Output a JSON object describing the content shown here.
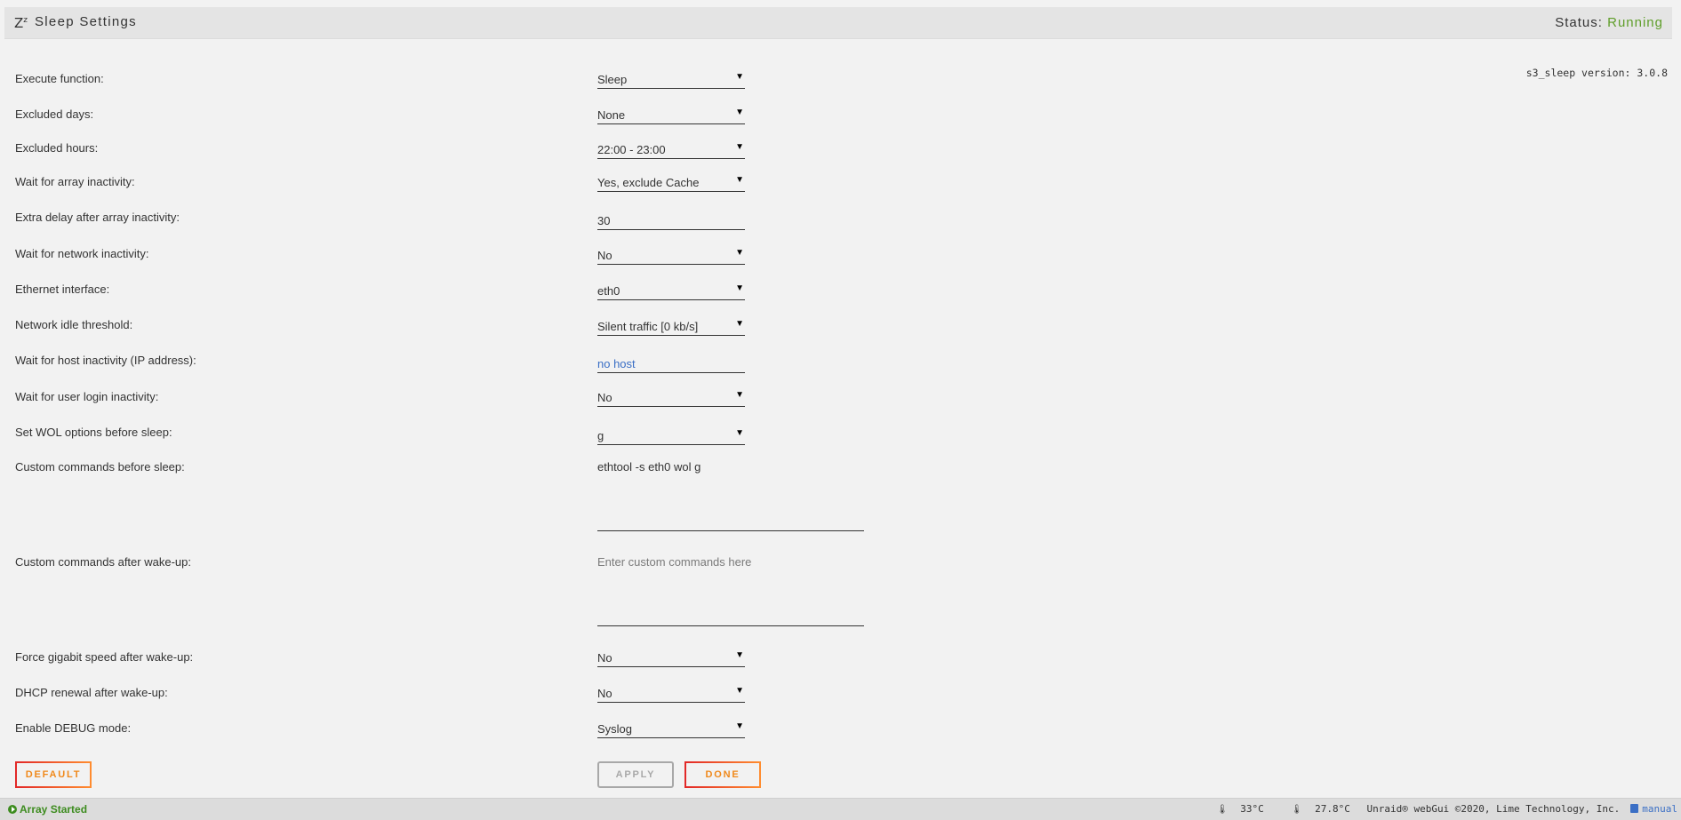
{
  "header": {
    "zz_icon": "Z",
    "zz_sup": "z",
    "title": "Sleep Settings",
    "status_label": "Status:",
    "status_value": "Running",
    "status_color": "#5f9e2a"
  },
  "version": "s3_sleep version: 3.0.8",
  "fields": {
    "execute_function": {
      "label": "Execute function:",
      "value": "Sleep"
    },
    "excluded_days": {
      "label": "Excluded days:",
      "value": "None"
    },
    "excluded_hours": {
      "label": "Excluded hours:",
      "value": "22:00 - 23:00"
    },
    "wait_array": {
      "label": "Wait for array inactivity:",
      "value": "Yes, exclude Cache"
    },
    "extra_delay": {
      "label": "Extra delay after array inactivity:",
      "value": "30"
    },
    "wait_network": {
      "label": "Wait for network inactivity:",
      "value": "No"
    },
    "ethernet": {
      "label": "Ethernet interface:",
      "value": "eth0"
    },
    "net_threshold": {
      "label": "Network idle threshold:",
      "value": "Silent traffic [0 kb/s]"
    },
    "wait_host": {
      "label": "Wait for host inactivity (IP address):",
      "value": "no host"
    },
    "wait_login": {
      "label": "Wait for user login inactivity:",
      "value": "No"
    },
    "wol": {
      "label": "Set WOL options before sleep:",
      "value": "g"
    },
    "cmd_before": {
      "label": "Custom commands before sleep:",
      "value": "ethtool -s eth0 wol g"
    },
    "cmd_after": {
      "label": "Custom commands after wake-up:",
      "placeholder": "Enter custom commands here"
    },
    "gigabit": {
      "label": "Force gigabit speed after wake-up:",
      "value": "No"
    },
    "dhcp": {
      "label": "DHCP renewal after wake-up:",
      "value": "No"
    },
    "debug": {
      "label": "Enable DEBUG mode:",
      "value": "Syslog"
    }
  },
  "buttons": {
    "default": "DEFAULT",
    "apply": "APPLY",
    "done": "DONE"
  },
  "footer": {
    "array_status": "Array Started",
    "temp1": "33°C",
    "temp2": "27.8°C",
    "copyright": "Unraid® webGui ©2020, Lime Technology, Inc.",
    "manual": "manual"
  },
  "icons": [
    "zz-sleep-icon",
    "dropdown-arrow-icon",
    "play-circle-icon",
    "thermometer-icon",
    "book-icon"
  ]
}
